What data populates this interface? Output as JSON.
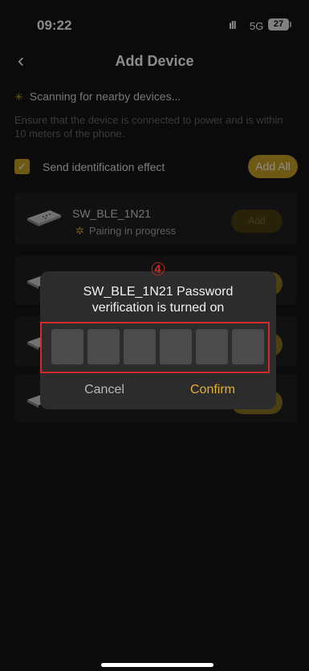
{
  "status": {
    "time": "09:22",
    "network": "5G",
    "battery": "27"
  },
  "nav": {
    "back": "‹",
    "title": "Add Device"
  },
  "scan": {
    "text": "Scanning for nearby devices...",
    "hint": "Ensure that the device is connected to power and is within 10 meters of the phone."
  },
  "identify": {
    "label": "Send identification effect",
    "checked": true,
    "check_mark": "✓"
  },
  "add_all_label": "Add All",
  "devices": [
    {
      "name": "SW_BLE_1N21",
      "status": "Pairing in progress",
      "button": "Add"
    }
  ],
  "dialog": {
    "step_marker": "④",
    "title_line1": "SW_BLE_1N21 Password",
    "title_line2": "verification is turned on",
    "code_digits": 6,
    "cancel": "Cancel",
    "confirm": "Confirm"
  },
  "colors": {
    "accent": "#c9a227",
    "highlight": "#d12a2a",
    "background": "#141414"
  }
}
